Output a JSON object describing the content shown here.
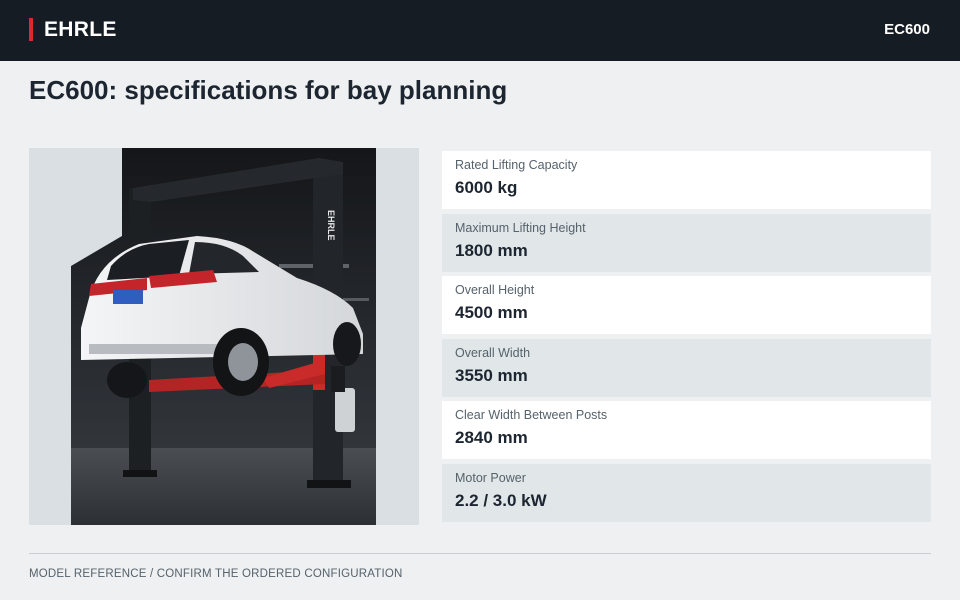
{
  "header": {
    "brand": "EHRLE",
    "model": "EC600",
    "accent_color": "#d92b2b",
    "bar_color": "#161c23"
  },
  "page": {
    "title": "EC600: specifications for bay planning"
  },
  "photo": {
    "post_lettering": "EHRLE",
    "lift_color": "#d92b2b"
  },
  "specs": [
    {
      "label": "Rated Lifting Capacity",
      "value": "6000 kg"
    },
    {
      "label": "Maximum Lifting Height",
      "value": "1800 mm"
    },
    {
      "label": "Overall Height",
      "value": "4500 mm"
    },
    {
      "label": "Overall Width",
      "value": "3550 mm"
    },
    {
      "label": "Clear Width Between Posts",
      "value": "2840 mm"
    },
    {
      "label": "Motor Power",
      "value": "2.2 / 3.0 kW"
    }
  ],
  "footer": {
    "note": "MODEL REFERENCE / CONFIRM THE ORDERED CONFIGURATION"
  }
}
